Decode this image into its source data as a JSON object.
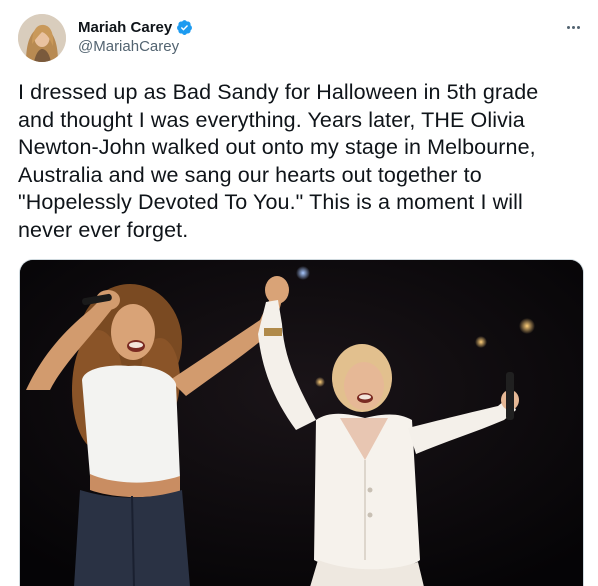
{
  "tweet": {
    "author": {
      "display_name": "Mariah Carey",
      "handle": "@MariahCarey",
      "verified": true
    },
    "text_lines": [
      "I dressed up as Bad Sandy for Halloween in 5th grade",
      "and thought I was everything. Years later, THE Olivia",
      "Newton-John walked out onto my stage in Melbourne,",
      "Australia and we sang our hearts out together to",
      "\"Hopelessly Devoted To You.\" This is a moment I will",
      "never ever forget."
    ],
    "icons": {
      "verified": "verified-badge-icon",
      "more": "more-options-icon"
    },
    "colors": {
      "verified_blue": "#1d9bf0",
      "text": "#0f1419",
      "secondary_text": "#536471"
    }
  }
}
